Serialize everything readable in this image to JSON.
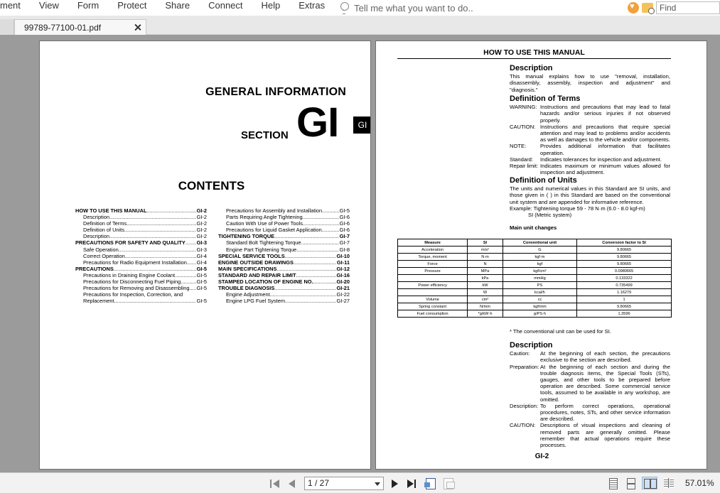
{
  "menubar": {
    "items": [
      "ment",
      "View",
      "Form",
      "Protect",
      "Share",
      "Connect",
      "Help",
      "Extras"
    ],
    "tellme": "Tell me what you want to do..",
    "find_placeholder": "Find"
  },
  "tab": {
    "filename": "99789-77100-01.pdf"
  },
  "left_page": {
    "general_info": "GENERAL INFORMATION",
    "section_label": "SECTION",
    "section_code": "GI",
    "tab_code": "GI",
    "contents_title": "CONTENTS",
    "toc_col1": [
      {
        "title": "HOW TO USE THIS MANUAL",
        "page": "GI-2",
        "bold": true
      },
      {
        "title": "Description",
        "page": "GI-2"
      },
      {
        "title": "Definition of Terms",
        "page": "GI-2"
      },
      {
        "title": "Definition of Units",
        "page": "GI-2"
      },
      {
        "title": "Description",
        "page": "GI-2"
      },
      {
        "title": "PRECAUTIONS FOR SAFETY AND QUALITY",
        "page": "GI-3",
        "bold": true
      },
      {
        "title": "Safe Operation",
        "page": "GI-3"
      },
      {
        "title": "Correct Operation",
        "page": "GI-4"
      },
      {
        "title": "Precautions for Radio Equipment Installation",
        "page": "GI-4"
      },
      {
        "title": "PRECAUTIONS",
        "page": "GI-5",
        "bold": true
      },
      {
        "title": "Precautions in Draining Engine Coolant",
        "page": "GI-5"
      },
      {
        "title": "Precautions for Disconnecting Fuel Piping",
        "page": "GI-5"
      },
      {
        "title": "Precautions for Removing and Disassembling",
        "page": "GI-5"
      },
      {
        "title": "Precautions for Inspection, Correction, and",
        "page": ""
      },
      {
        "title": "Replacement",
        "page": "GI-5"
      }
    ],
    "toc_col2": [
      {
        "title": "Precautions for Assembly and Installation",
        "page": "GI-5"
      },
      {
        "title": "Parts Requiring Angle Tightening",
        "page": "GI-6"
      },
      {
        "title": "Caution With Use of Power Tools",
        "page": "GI-6"
      },
      {
        "title": "Precautions for Liquid Gasket Application",
        "page": "GI-6"
      },
      {
        "title": "TIGHTENING TORQUE",
        "page": "GI-7",
        "bold": true
      },
      {
        "title": "Standard Bolt Tightening Torque",
        "page": "GI-7"
      },
      {
        "title": "Engine Part Tightening Torque",
        "page": "GI-8"
      },
      {
        "title": "SPECIAL SERVICE TOOLS",
        "page": "GI-10",
        "bold": true
      },
      {
        "title": "ENGINE OUTSIDE DRAWINGS",
        "page": "GI-11",
        "bold": true
      },
      {
        "title": "MAIN SPECIFICATIONS",
        "page": "GI-12",
        "bold": true
      },
      {
        "title": "STANDARD AND REPAIR LIMIT",
        "page": "GI-16",
        "bold": true
      },
      {
        "title": "STAMPED LOCATION OF ENGINE NO.",
        "page": "GI-20",
        "bold": true
      },
      {
        "title": "TROUBLE DIAGNOSIS",
        "page": "GI-21",
        "bold": true
      },
      {
        "title": "Engine Adjustment",
        "page": "GI-22"
      },
      {
        "title": "Engine LPG Fuel System",
        "page": "GI-27"
      }
    ]
  },
  "right_page": {
    "header": "HOW TO USE THIS MANUAL",
    "desc1_title": "Description",
    "desc1_text": "This manual explains how to use \"removal, installation, disassembly, assembly, inspection and adjustment\" and \"diagnosis.\"",
    "terms_title": "Definition of Terms",
    "terms": [
      {
        "term": "WARNING:",
        "text": "Instructions and precautions that may lead to fatal hazards and/or serious injuries if not observed properly."
      },
      {
        "term": "CAUTION:",
        "text": "Instructions and precautions that require special attention and may lead to problems and/or accidents as well as damages to the vehicle and/or components."
      },
      {
        "term": "NOTE:",
        "text": "Provides additional information that facilitates operation."
      },
      {
        "term": "Standard:",
        "text": "Indicates tolerances for inspection and adjustment."
      },
      {
        "term": "Repair limit:",
        "text": "Indicates maximum or minimum values allowed for inspection and adjustment."
      }
    ],
    "units_title": "Definition of Units",
    "units_text": "The units and numerical values in this Standard are SI units, and those given in ( ) in this Standard are based on the conventional unit system and are appended for informative reference.",
    "units_example": "Example: Tightening torque 59 - 78 N·m (6.0 - 8.0 kgf-m)",
    "units_example_si": "SI (Metric system)",
    "main_unit_changes": "Main unit changes",
    "table_headers": [
      "Measure",
      "SI",
      "Conventional unit",
      "Conversion factor to SI"
    ],
    "table_rows": [
      [
        "Acceleration",
        "m/s²",
        "G",
        "9.80665"
      ],
      [
        "Torque, moment",
        "N·m",
        "kgf·m",
        "9.80665"
      ],
      [
        "Force",
        "N",
        "kgf",
        "9.80665"
      ],
      [
        "Pressure",
        "MPa",
        "kgf/cm²",
        "0.0980665"
      ],
      [
        "",
        "kPa",
        "mmHg",
        "0.133322"
      ],
      [
        "Power efficiency",
        "kW",
        "PS",
        "0.735499"
      ],
      [
        "",
        "W",
        "kcal/h",
        "1.16279"
      ],
      [
        "Volume",
        "cm³",
        "cc",
        "1"
      ],
      [
        "Spring constant",
        "N/mm",
        "kgf/mm",
        "9.80665"
      ],
      [
        "Fuel consumption",
        "*g/kW·h",
        "g/PS·h",
        "1.3596"
      ]
    ],
    "table_note": "* The conventional unit can be used for SI.",
    "desc2_title": "Description",
    "desc2_items": [
      {
        "term": "Caution:",
        "text": "At the beginning of each section, the precautions exclusive to the section are described."
      },
      {
        "term": "Preparation:",
        "text": "At the beginning of each section and during the trouble diagnosis items, the Special Tools (STs), gauges, and other tools to be prepared before operation are described. Some commercial service tools, assumed to be available in any workshop, are omitted."
      },
      {
        "term": "Description:",
        "text": "To perform correct operations, operational procedures, notes, STs, and other service information are described."
      },
      {
        "term": "CAUTION:",
        "text": "Descriptions of visual inspections and cleaning of removed parts are generally omitted. Please remember that actual operations require these processes."
      }
    ],
    "page_number": "GI-2"
  },
  "statusbar": {
    "page_indicator": "1 / 27",
    "zoom": "57.01%"
  }
}
